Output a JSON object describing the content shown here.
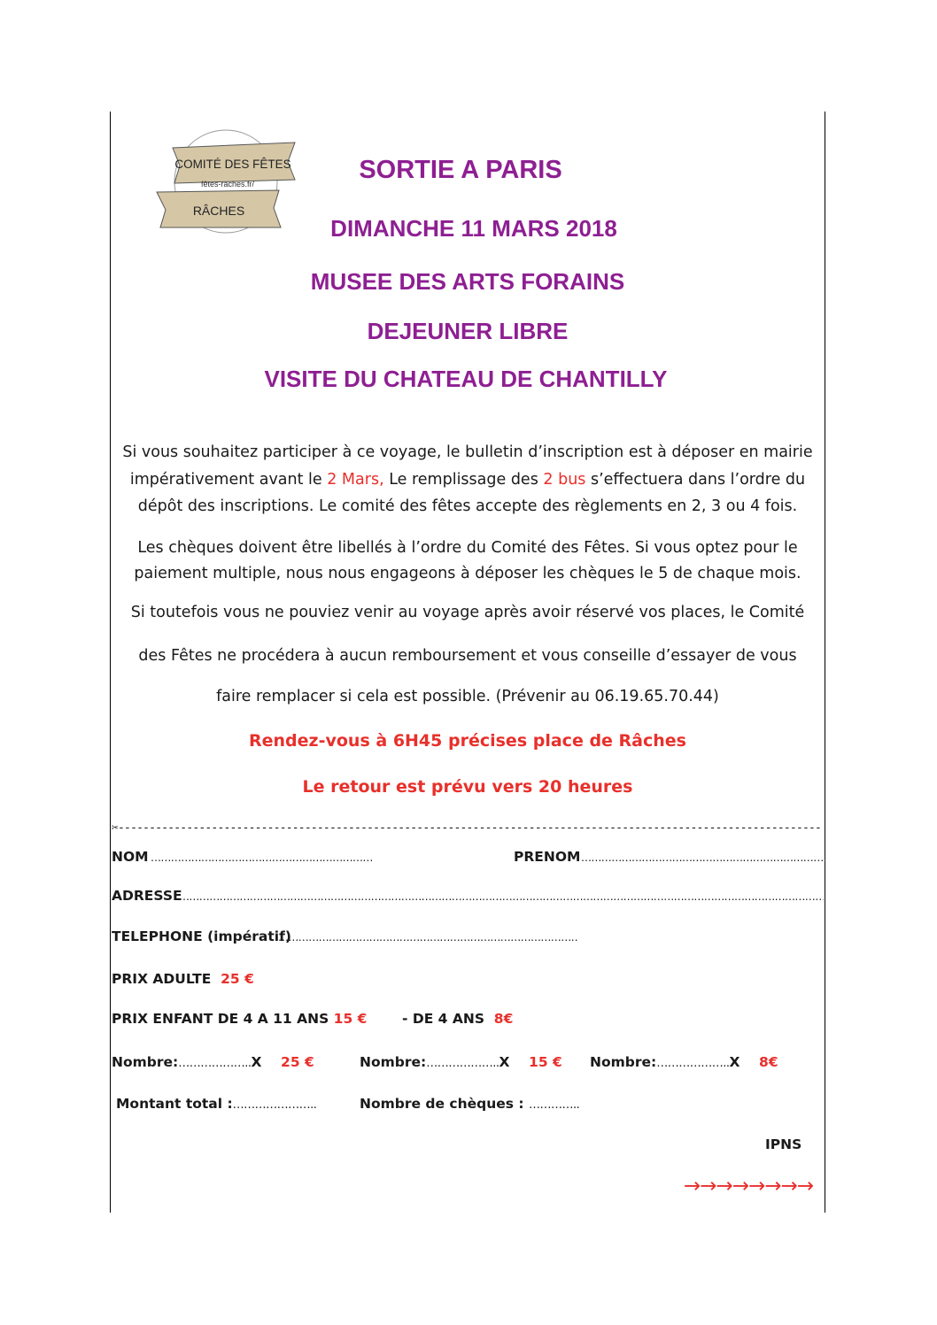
{
  "logo": {
    "top_label": "COMITÉ DES FÊTES",
    "url_label": "fêtes-raches.fr/",
    "bottom_label": "RÂCHES"
  },
  "titles": {
    "t1": "SORTIE A PARIS",
    "t2": "DIMANCHE 11 MARS 2018",
    "t3": "MUSEE DES ARTS FORAINS",
    "t4": "DEJEUNER LIBRE",
    "t5": "VISITE DU CHATEAU DE CHANTILLY"
  },
  "paragraphs": {
    "p1_a": "Si vous souhaitez participer à ce voyage, le bulletin d’inscription est à déposer en mairie impérativement avant  le  ",
    "p1_red1": "2 Mars,",
    "p1_b": " Le remplissage des  ",
    "p1_red2": "2 bus",
    "p1_c": " s’effectuera dans l’ordre du dépôt des inscriptions. Le comité des fêtes  accepte des règlements en 2, 3 ou 4 fois.",
    "p2": "Les chèques  doivent être libellés à l’ordre du  Comité des Fêtes. Si vous optez pour le paiement multiple, nous nous engageons à déposer les chèques le  5 de chaque  mois.",
    "p3": "Si toutefois vous ne pouviez venir au voyage après  avoir réservé vos places, le Comité",
    "p4": "des Fêtes ne procédera à aucun remboursement et vous conseille d’essayer de vous",
    "p5": "faire remplacer si cela est possible. (Prévenir au 06.19.65.70.44)"
  },
  "rendezvous": {
    "line1": "Rendez-vous à 6H45 précises place de Râches",
    "line2": "Le retour est prévu vers 20 heures"
  },
  "cut_icon": "scissors-icon",
  "form": {
    "nom_label": "NOM",
    "prenom_label": "PRENOM",
    "adresse_label": "ADRESSE",
    "telephone_label": "TELEPHONE (impératif)",
    "prix_adulte_label": "PRIX ADULTE",
    "prix_adulte_value": "25 €",
    "prix_enfant_label": "PRIX ENFANT DE 4 A 11 ANS",
    "prix_enfant_value": "15 €",
    "moins4_label": "- DE 4 ANS",
    "moins4_value": "8€",
    "nombre_label_1": "Nombre:",
    "nombre_x_1": "X",
    "nombre_price_1": "25 €",
    "nombre_label_2": "Nombre:",
    "nombre_x_2": "X",
    "nombre_price_2": "15 €",
    "nombre_label_3": "Nombre:",
    "nombre_x_3": "X",
    "nombre_price_3": "8€",
    "montant_label": "Montant total :",
    "cheques_label": "Nombre  de chèques :",
    "ipns": "IPNS"
  },
  "arrows": "→→→→→→→→",
  "colors": {
    "title": "#8e1f92",
    "accent_red": "#e8302b",
    "logo_tan": "#d5c7a6"
  }
}
